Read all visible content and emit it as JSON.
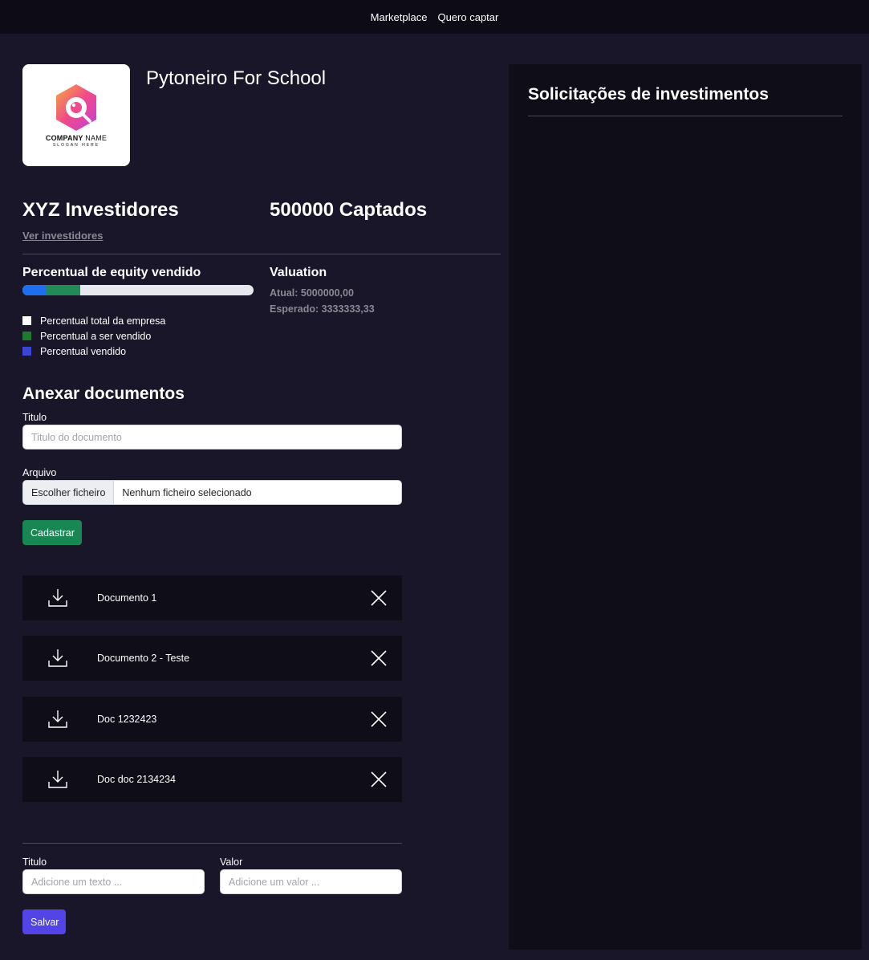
{
  "nav": {
    "items": [
      "Marketplace",
      "Quero captar"
    ]
  },
  "company": {
    "name": "Pytoneiro For School",
    "logo": {
      "name_bold": "COMPANY",
      "name_light": " NAME",
      "slogan": "SLOGAN HERE"
    }
  },
  "stats": {
    "investors": "XYZ Investidores",
    "see_investors": "Ver investidores",
    "raised": "500000 Captados"
  },
  "equity": {
    "label": "Percentual de equity vendido",
    "progress": {
      "sold_fraction": 0.1,
      "to_sell_fraction": 0.15
    },
    "legend": [
      {
        "label": "Percentual total da empresa",
        "color": "#ffffff"
      },
      {
        "label": "Percentual a ser vendido",
        "color": "#1f7a2b"
      },
      {
        "label": "Percentual vendido",
        "color": "#3b46d6"
      }
    ]
  },
  "valuation": {
    "label": "Valuation",
    "current": "Atual: 5000000,00",
    "expected": "Esperado: 3333333,33"
  },
  "attach": {
    "title": "Anexar documentos",
    "title_label": "Titulo",
    "title_placeholder": "Titulo do documento",
    "file_label": "Arquivo",
    "file_button": "Escolher ficheiro",
    "file_status": "Nenhum ficheiro selecionado",
    "submit": "Cadastrar"
  },
  "documents": [
    "Documento 1",
    "Documento 2 - Teste",
    "Doc 1232423",
    "Doc doc 2134234"
  ],
  "extra_form": {
    "title_label": "Titulo",
    "title_placeholder": "Adicione um texto ...",
    "value_label": "Valor",
    "value_placeholder": "Adicione um valor ...",
    "submit": "Salvar"
  },
  "requests": {
    "title": "Solicitações de investimentos"
  },
  "colors": {
    "background": "#181628",
    "panel": "#0e0d18",
    "progress_sold": "#1e6ef0",
    "progress_to_sell": "#218a56",
    "button_green": "#198754",
    "button_purple": "#5244e6"
  }
}
